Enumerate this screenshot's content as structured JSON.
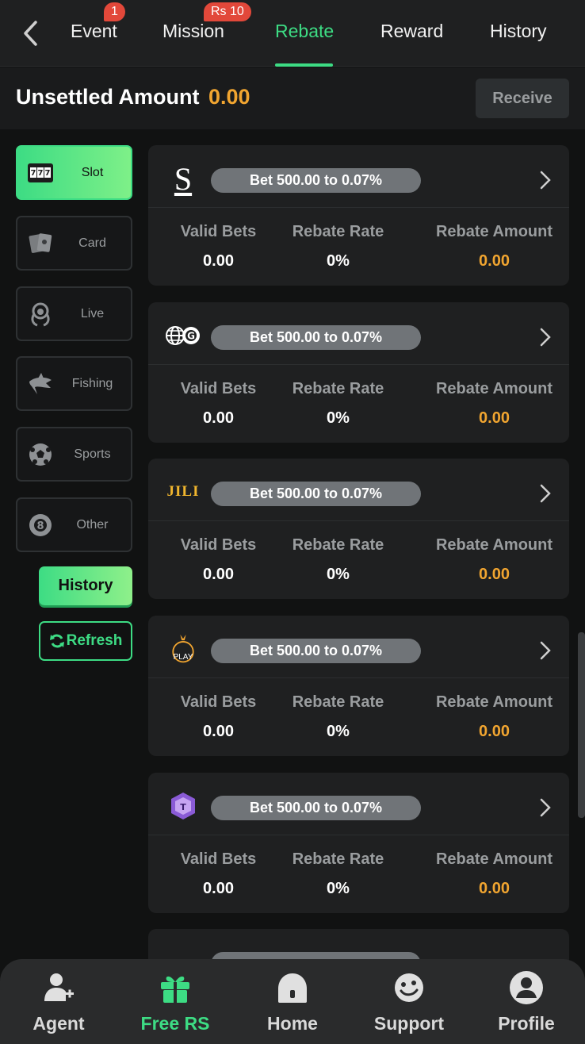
{
  "nav": {
    "tabs": [
      {
        "label": "Event",
        "badge": "1"
      },
      {
        "label": "Mission",
        "badge": "Rs 10"
      },
      {
        "label": "Rebate",
        "badge": ""
      },
      {
        "label": "Reward",
        "badge": ""
      },
      {
        "label": "History",
        "badge": ""
      }
    ],
    "active_tab": "Rebate"
  },
  "unsettled": {
    "label": "Unsettled Amount",
    "amount": "0.00",
    "receive_label": "Receive"
  },
  "categories": [
    {
      "label": "Slot",
      "icon": "slot-machine-icon",
      "active": true
    },
    {
      "label": "Card",
      "icon": "playing-cards-icon",
      "active": false
    },
    {
      "label": "Live",
      "icon": "dealer-icon",
      "active": false
    },
    {
      "label": "Fishing",
      "icon": "shark-icon",
      "active": false
    },
    {
      "label": "Sports",
      "icon": "soccer-ball-icon",
      "active": false
    },
    {
      "label": "Other",
      "icon": "eight-ball-icon",
      "active": false
    }
  ],
  "side_buttons": {
    "history": "History",
    "refresh": "Refresh"
  },
  "columns": {
    "valid_bets": "Valid Bets",
    "rebate_rate": "Rebate Rate",
    "rebate_amount": "Rebate Amount"
  },
  "providers": [
    {
      "logo": "s-provider-logo",
      "logo_text": "S",
      "pill": "Bet 500.00 to 0.07%",
      "valid_bets": "0.00",
      "rebate_rate": "0%",
      "rebate_amount": "0.00"
    },
    {
      "logo": "globe-g-provider-logo",
      "logo_text": "",
      "pill": "Bet 500.00 to 0.07%",
      "valid_bets": "0.00",
      "rebate_rate": "0%",
      "rebate_amount": "0.00"
    },
    {
      "logo": "jili-provider-logo",
      "logo_text": "JILI",
      "pill": "Bet 500.00 to 0.07%",
      "valid_bets": "0.00",
      "rebate_rate": "0%",
      "rebate_amount": "0.00"
    },
    {
      "logo": "play-provider-logo",
      "logo_text": "PLAY",
      "pill": "Bet 500.00 to 0.07%",
      "valid_bets": "0.00",
      "rebate_rate": "0%",
      "rebate_amount": "0.00"
    },
    {
      "logo": "hexagon-provider-logo",
      "logo_text": "",
      "pill": "Bet 500.00 to 0.07%",
      "valid_bets": "0.00",
      "rebate_rate": "0%",
      "rebate_amount": "0.00"
    }
  ],
  "bottom_nav": [
    {
      "label": "Agent",
      "icon": "agent-add-icon",
      "active": false
    },
    {
      "label": "Free RS",
      "icon": "gift-icon",
      "active": true
    },
    {
      "label": "Home",
      "icon": "home-icon",
      "active": false
    },
    {
      "label": "Support",
      "icon": "support-face-icon",
      "active": false
    },
    {
      "label": "Profile",
      "icon": "profile-icon",
      "active": false
    }
  ],
  "colors": {
    "accent": "#3ddc84",
    "amount": "#f1a530",
    "badge": "#e2483a"
  }
}
